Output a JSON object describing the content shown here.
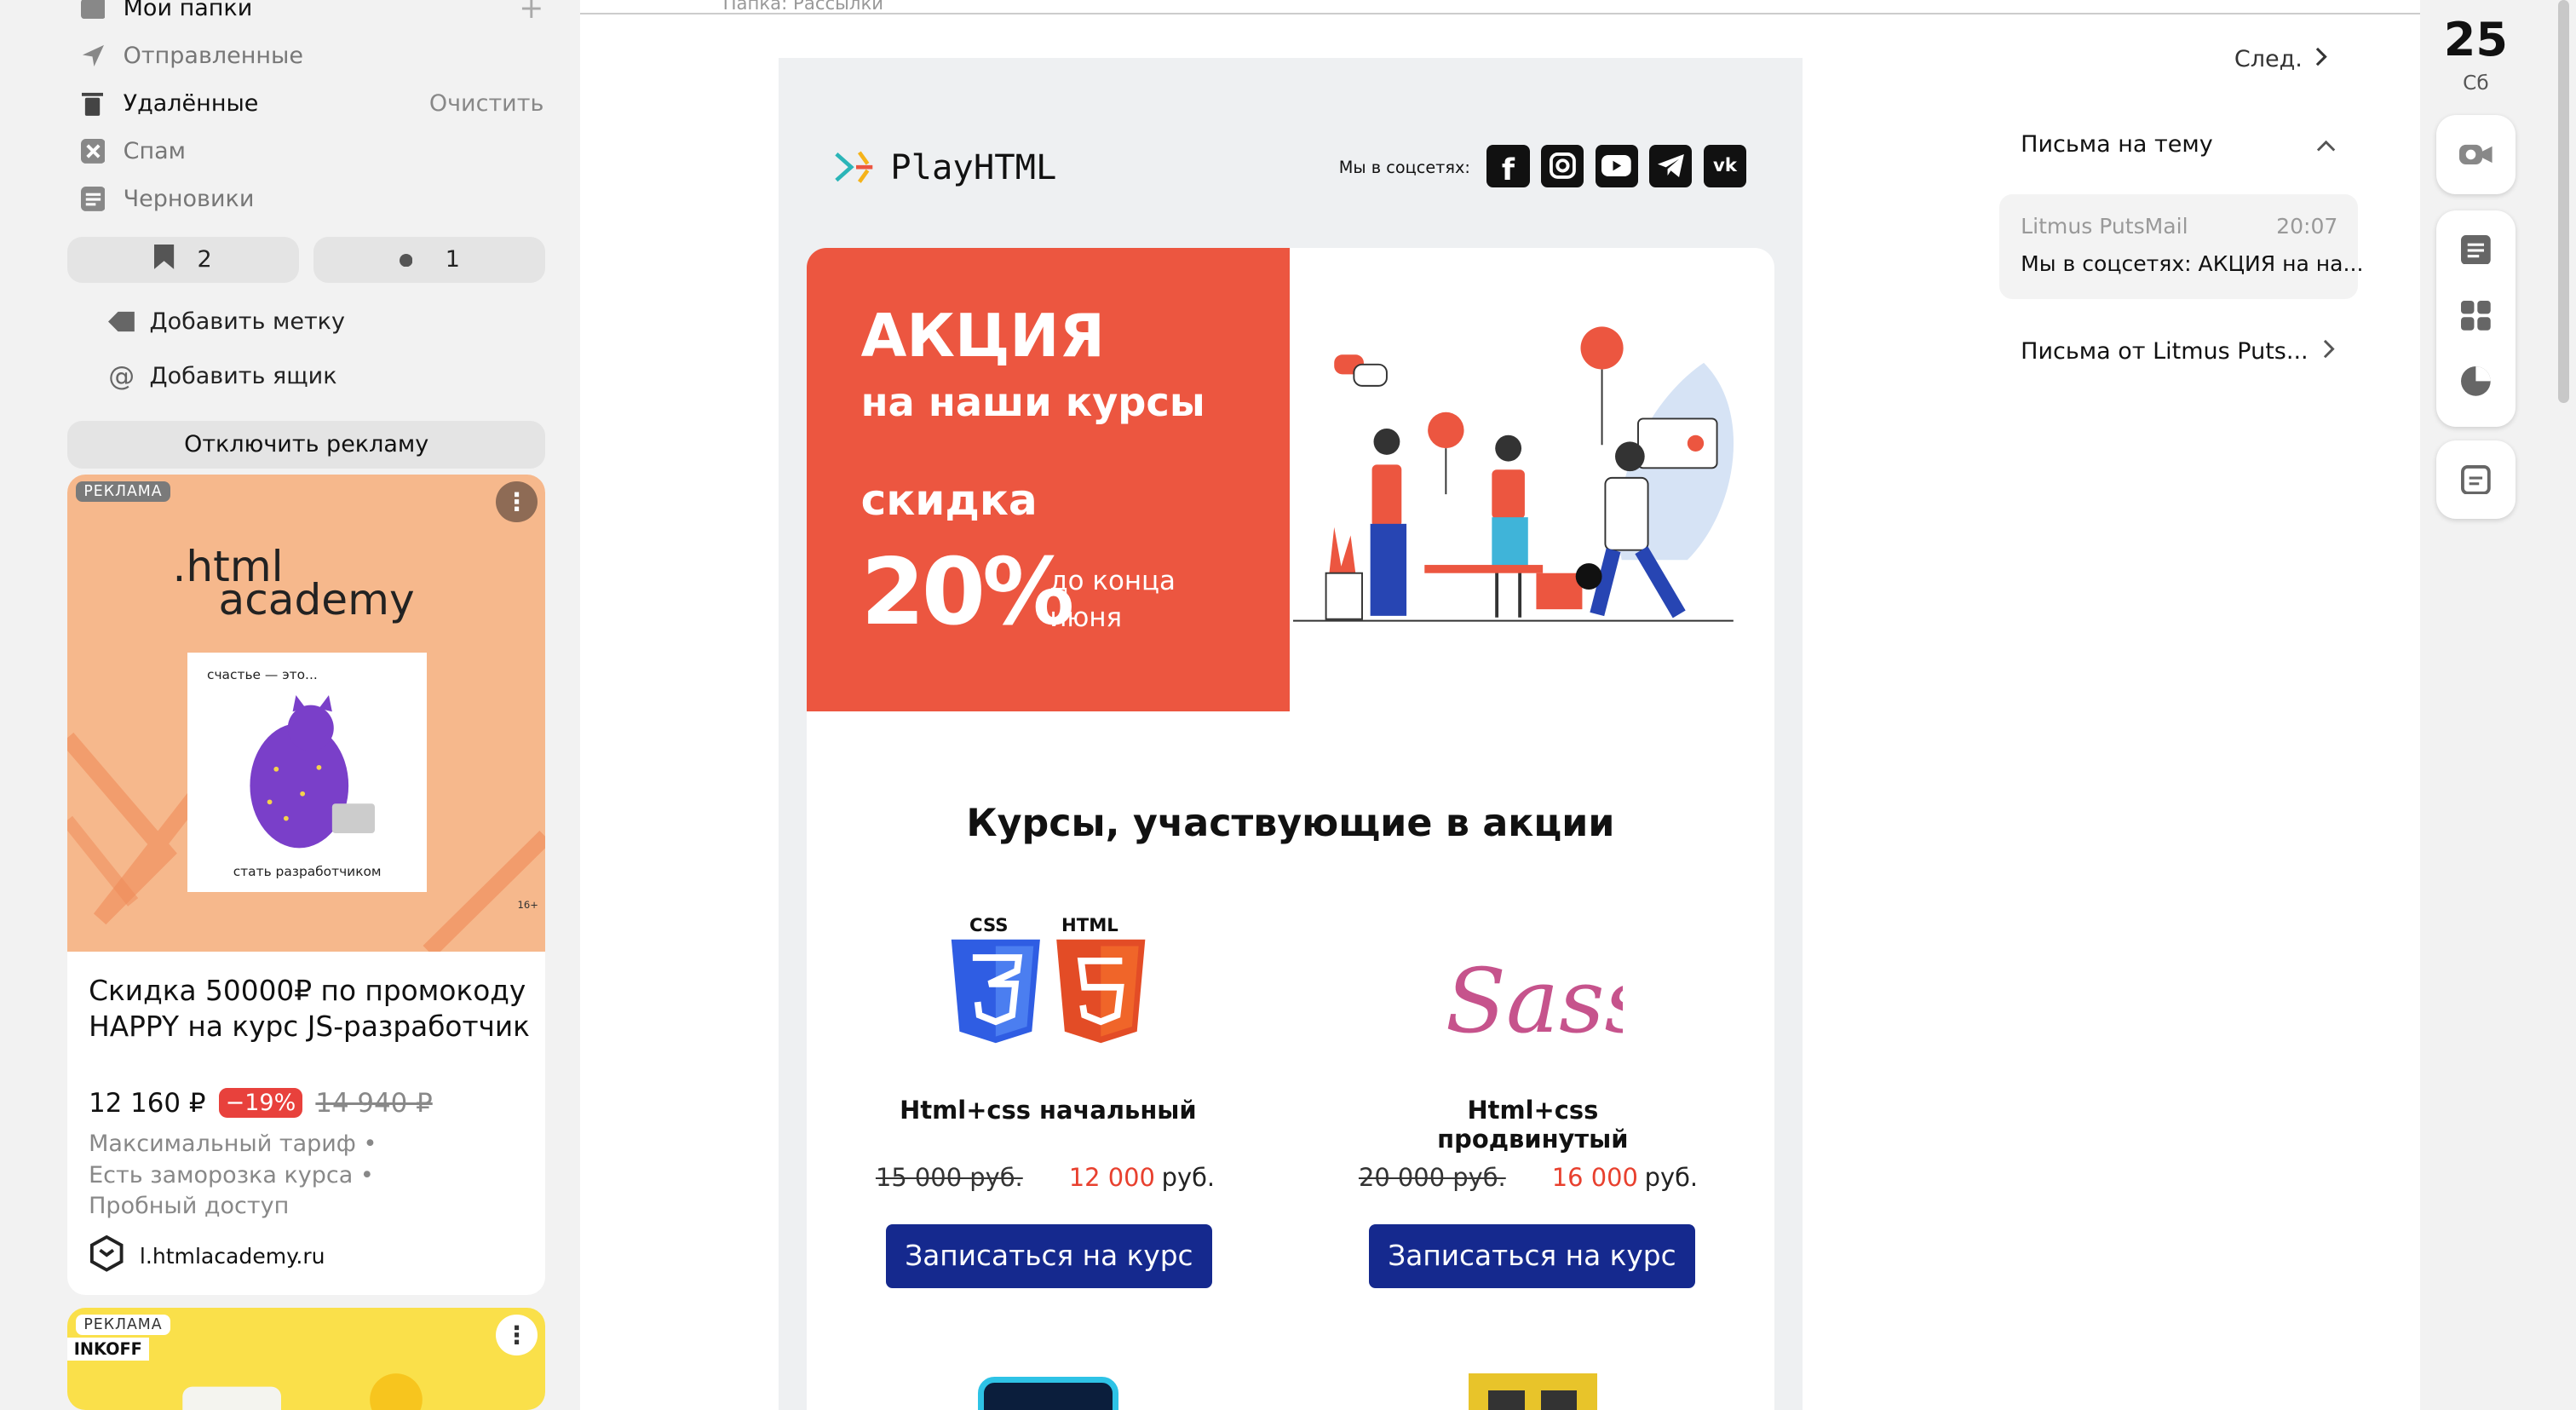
{
  "sidebar": {
    "my_folders": "Мои папки",
    "folders": [
      {
        "label": "Отправленные"
      },
      {
        "label": "Удалённые",
        "action": "Очистить"
      },
      {
        "label": "Спам"
      },
      {
        "label": "Черновики"
      }
    ],
    "chips": {
      "bookmarks": "2",
      "unread": "1"
    },
    "add_label": "Добавить метку",
    "add_mailbox": "Добавить ящик",
    "disable_ads": "Отключить рекламу",
    "ad1": {
      "badge": "РЕКЛАМА",
      "logo_line1": ".html",
      "logo_line2": "academy",
      "book_top": "счастье — это...",
      "book_bottom": "стать разработчиком",
      "age": "16+",
      "title": "Скидка 50000₽ по промокоду HAPPY на курс JS-разработчик",
      "price": "12 160 ₽",
      "discount": "−19%",
      "old_price": "14 940 ₽",
      "features": [
        "Максимальный тариф •",
        "Есть заморозка курса •",
        "Пробный доступ"
      ],
      "domain": "l.htmlacademy.ru"
    },
    "ad2": {
      "badge": "РЕКЛАМА",
      "brand": "INKOFF"
    }
  },
  "breadcrumb": "Папка: Рассылки",
  "email": {
    "logo": "PlayHTML",
    "social_label": "Мы в соцсетях:",
    "social": [
      "f",
      "ig",
      "yt",
      "tg",
      "vk"
    ],
    "banner": {
      "line1": "АКЦИЯ",
      "line2": "на наши курсы",
      "line3": "скидка",
      "percent": "20%",
      "until1": "до конца",
      "until2": "июня"
    },
    "section_title": "Курсы, участвующие в акции",
    "courses": [
      {
        "icon_label1": "CSS",
        "icon_label2": "HTML",
        "name": "Html+css начальный",
        "old": "15 000 руб.",
        "new": "12 000",
        "unit": "руб.",
        "button": "Записаться на курс"
      },
      {
        "icon_label1": "Sass",
        "name": "Html+css продвинутый",
        "old": "20 000 руб.",
        "new": "16 000",
        "unit": "руб.",
        "button": "Записаться на курс"
      }
    ]
  },
  "right": {
    "next": "След.",
    "thread_title": "Письма на тему",
    "thread_item": {
      "sender": "Litmus PutsMail",
      "time": "20:07",
      "subject": "Мы в соцсетях: АКЦИЯ на на..."
    },
    "from_row": "Письма от Litmus Puts..."
  },
  "calendar": {
    "day": "25",
    "weekday": "Сб"
  },
  "colors": {
    "accent_red": "#ec5640",
    "button_blue": "#15298e",
    "price_red": "#e8402e"
  }
}
